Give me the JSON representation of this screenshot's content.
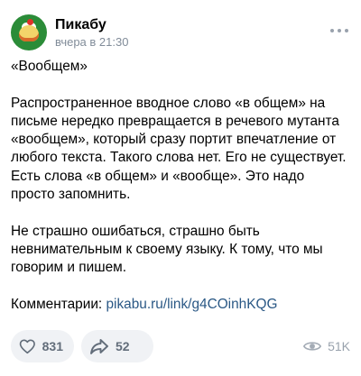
{
  "header": {
    "channel_name": "Пикабу",
    "post_time": "вчера в 21:30"
  },
  "post": {
    "paragraphs": [
      "«Вообщем»",
      "Распространенное вводное слово «в общем» на письме нередко превращается в речевого мутанта «вообщем», который сразу портит впечатление от любого текста. Такого слова нет. Его не существует. Есть слова «в общем» и «вообще». Это надо просто запомнить.",
      "Не страшно ошибаться, страшно быть невнимательным к своему языку. К тому, что мы говорим и пишем."
    ],
    "comments_label": "Комментарии: ",
    "comments_link": "pikabu.ru/link/g4COinhKQG"
  },
  "footer": {
    "likes_count": "831",
    "shares_count": "52",
    "views_count": "51K"
  },
  "icons": {
    "avatar": "pikabu-cake-logo",
    "more": "more-horizontal-icon",
    "like": "heart-icon",
    "share": "share-arrow-icon",
    "views": "eye-icon"
  },
  "colors": {
    "link": "#2a5885",
    "secondary_text": "#818c99",
    "pill_background": "#f0f2f5",
    "avatar_background": "#2b8c38"
  }
}
